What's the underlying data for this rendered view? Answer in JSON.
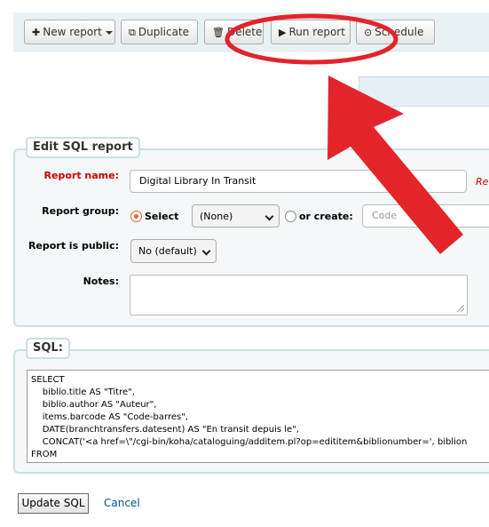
{
  "toolbar": {
    "new_report": "New report",
    "duplicate": "Duplicate",
    "delete": "Delete",
    "run_report": "Run report",
    "schedule": "Schedule"
  },
  "edit_sql_report": {
    "legend": "Edit SQL report",
    "report_name_label": "Report name:",
    "report_name_value": "Digital Library In Transit",
    "required_hint": "Re",
    "report_group_label": "Report group:",
    "select_label": "Select",
    "group_selected": "(None)",
    "or_create_label": "or create:",
    "code_placeholder": "Code",
    "is_public_label": "Report is public:",
    "is_public_value": "No (default)",
    "notes_label": "Notes:"
  },
  "sql": {
    "legend": "SQL:",
    "lines": [
      "SELECT",
      "    biblio.title AS \"Titre\",",
      "    biblio.author AS \"Auteur\",",
      "    items.barcode AS \"Code-barres\",",
      "    DATE(branchtransfers.datesent) AS \"En transit depuis le\",",
      "    CONCAT('<a href=\\\"/cgi-bin/koha/cataloguing/additem.pl?op=edititem&biblionumber=', biblion",
      "FROM"
    ]
  },
  "actions": {
    "update_sql": "Update SQL",
    "cancel": "Cancel"
  },
  "annotation_colors": {
    "highlight": "#e3242b"
  }
}
